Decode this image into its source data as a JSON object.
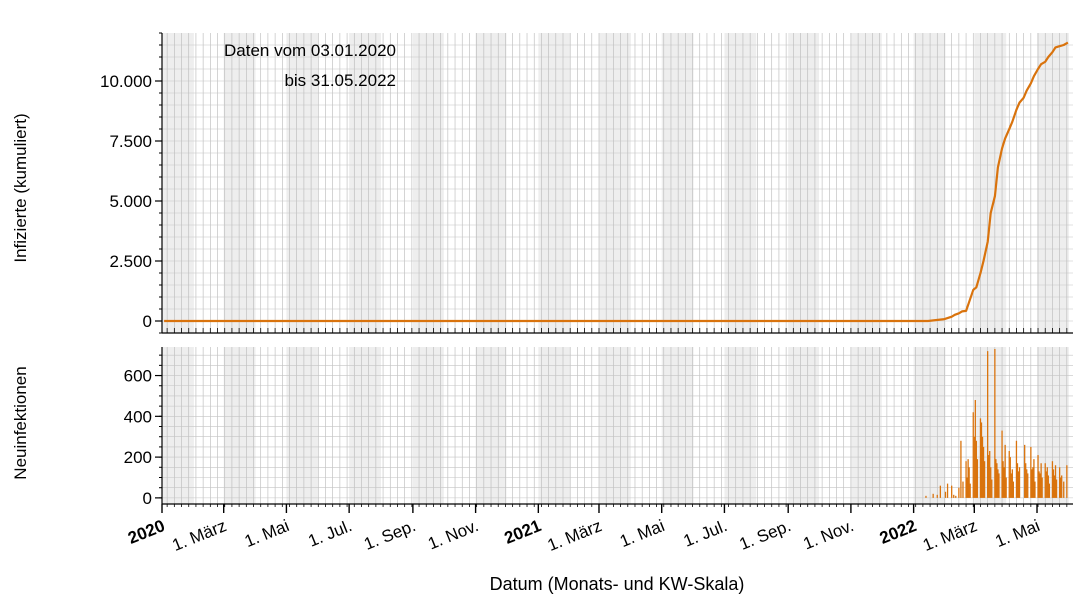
{
  "chart_data": [
    {
      "type": "line",
      "ylabel": "Infizierte (kumuliert)",
      "annotation_line1": "Daten vom 03.01.2020",
      "annotation_line2": "bis 31.05.2022",
      "ylim": [
        -500,
        12000
      ],
      "yticks": [
        0,
        2500,
        5000,
        7500,
        10000
      ],
      "ytick_labels": [
        "0",
        "2.500",
        "5.000",
        "7.500",
        "10.000"
      ],
      "color": "#d9730d",
      "series": [
        {
          "x": [
            "2020-01-03",
            "2021-12-31",
            "2022-01-15",
            "2022-01-31",
            "2022-02-07",
            "2022-02-10",
            "2022-02-14",
            "2022-02-17",
            "2022-02-21",
            "2022-02-24",
            "2022-02-28",
            "2022-03-03",
            "2022-03-07",
            "2022-03-10",
            "2022-03-14",
            "2022-03-17",
            "2022-03-21",
            "2022-03-24",
            "2022-03-28",
            "2022-03-31",
            "2022-04-04",
            "2022-04-07",
            "2022-04-11",
            "2022-04-14",
            "2022-04-18",
            "2022-04-21",
            "2022-04-25",
            "2022-04-28",
            "2022-05-02",
            "2022-05-05",
            "2022-05-09",
            "2022-05-12",
            "2022-05-16",
            "2022-05-19",
            "2022-05-23",
            "2022-05-27",
            "2022-05-31"
          ],
          "y": [
            0,
            0,
            0,
            80,
            180,
            260,
            320,
            400,
            420,
            800,
            1300,
            1400,
            2000,
            2500,
            3300,
            4500,
            5200,
            6400,
            7200,
            7600,
            8000,
            8300,
            8800,
            9100,
            9300,
            9600,
            9900,
            10200,
            10500,
            10700,
            10800,
            11000,
            11200,
            11400,
            11450,
            11500,
            11600
          ]
        }
      ]
    },
    {
      "type": "bar",
      "ylabel": "Neuinfektionen",
      "ylim": [
        -30,
        740
      ],
      "yticks": [
        0,
        200,
        400,
        600
      ],
      "ytick_labels": [
        "0",
        "200",
        "400",
        "600"
      ],
      "color": "#d9730d",
      "dates": [
        "2022-01-13",
        "2022-01-20",
        "2022-01-24",
        "2022-01-27",
        "2022-02-01",
        "2022-02-03",
        "2022-02-07",
        "2022-02-09",
        "2022-02-11",
        "2022-02-14",
        "2022-02-16",
        "2022-02-18",
        "2022-02-21",
        "2022-02-22",
        "2022-02-23",
        "2022-02-24",
        "2022-02-25",
        "2022-02-28",
        "2022-03-01",
        "2022-03-02",
        "2022-03-03",
        "2022-03-04",
        "2022-03-07",
        "2022-03-08",
        "2022-03-09",
        "2022-03-10",
        "2022-03-11",
        "2022-03-14",
        "2022-03-15",
        "2022-03-16",
        "2022-03-17",
        "2022-03-18",
        "2022-03-21",
        "2022-03-22",
        "2022-03-23",
        "2022-03-24",
        "2022-03-25",
        "2022-03-28",
        "2022-03-29",
        "2022-03-30",
        "2022-03-31",
        "2022-04-01",
        "2022-04-04",
        "2022-04-05",
        "2022-04-06",
        "2022-04-07",
        "2022-04-08",
        "2022-04-11",
        "2022-04-12",
        "2022-04-13",
        "2022-04-14",
        "2022-04-19",
        "2022-04-20",
        "2022-04-21",
        "2022-04-22",
        "2022-04-25",
        "2022-04-26",
        "2022-04-27",
        "2022-04-28",
        "2022-04-29",
        "2022-05-02",
        "2022-05-03",
        "2022-05-04",
        "2022-05-05",
        "2022-05-06",
        "2022-05-09",
        "2022-05-10",
        "2022-05-11",
        "2022-05-12",
        "2022-05-13",
        "2022-05-16",
        "2022-05-17",
        "2022-05-18",
        "2022-05-19",
        "2022-05-20",
        "2022-05-23",
        "2022-05-24",
        "2022-05-25",
        "2022-05-27",
        "2022-05-30"
      ],
      "values": [
        10,
        20,
        15,
        60,
        30,
        70,
        60,
        15,
        10,
        50,
        280,
        80,
        180,
        100,
        190,
        150,
        70,
        420,
        300,
        480,
        280,
        190,
        390,
        370,
        300,
        250,
        180,
        720,
        210,
        230,
        150,
        90,
        730,
        190,
        170,
        140,
        120,
        330,
        180,
        150,
        260,
        100,
        230,
        200,
        120,
        140,
        80,
        280,
        170,
        130,
        150,
        260,
        170,
        140,
        120,
        250,
        140,
        150,
        190,
        80,
        210,
        130,
        120,
        170,
        100,
        170,
        130,
        150,
        110,
        70,
        180,
        140,
        110,
        160,
        90,
        150,
        100,
        110,
        80,
        160
      ]
    }
  ],
  "x_axis": {
    "label": "Datum (Monats- und KW-Skala)",
    "range": [
      "2020-01-01",
      "2022-06-05"
    ],
    "ticks": [
      {
        "date": "2020-01-01",
        "label": "2020",
        "bold": true
      },
      {
        "date": "2020-03-01",
        "label": "1. März",
        "bold": false
      },
      {
        "date": "2020-05-01",
        "label": "1. Mai",
        "bold": false
      },
      {
        "date": "2020-07-01",
        "label": "1. Jul.",
        "bold": false
      },
      {
        "date": "2020-09-01",
        "label": "1. Sep.",
        "bold": false
      },
      {
        "date": "2020-11-01",
        "label": "1. Nov.",
        "bold": false
      },
      {
        "date": "2021-01-01",
        "label": "2021",
        "bold": true
      },
      {
        "date": "2021-03-01",
        "label": "1. März",
        "bold": false
      },
      {
        "date": "2021-05-01",
        "label": "1. Mai",
        "bold": false
      },
      {
        "date": "2021-07-01",
        "label": "1. Jul.",
        "bold": false
      },
      {
        "date": "2021-09-01",
        "label": "1. Sep.",
        "bold": false
      },
      {
        "date": "2021-11-01",
        "label": "1. Nov.",
        "bold": false
      },
      {
        "date": "2022-01-01",
        "label": "2022",
        "bold": true
      },
      {
        "date": "2022-03-01",
        "label": "1. März",
        "bold": false
      },
      {
        "date": "2022-05-01",
        "label": "1. Mai",
        "bold": false
      }
    ]
  }
}
